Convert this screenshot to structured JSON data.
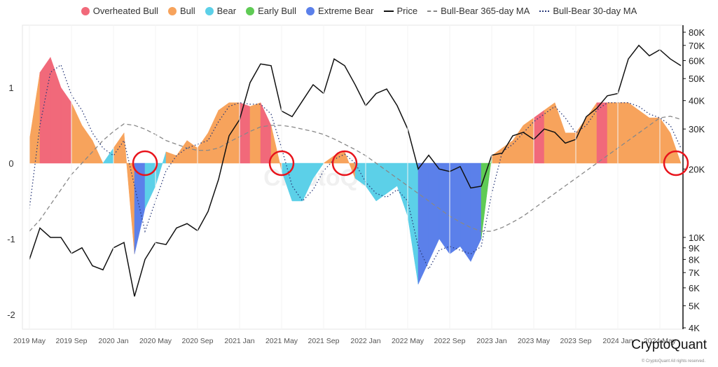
{
  "legend": [
    {
      "label": "Overheated Bull",
      "type": "dot",
      "color": "#f1697a"
    },
    {
      "label": "Bull",
      "type": "dot",
      "color": "#f7a35c"
    },
    {
      "label": "Bear",
      "type": "dot",
      "color": "#5cd0e8"
    },
    {
      "label": "Early Bull",
      "type": "dot",
      "color": "#5fcb55"
    },
    {
      "label": "Extreme Bear",
      "type": "dot",
      "color": "#5b80ea"
    },
    {
      "label": "Price",
      "type": "solid",
      "color": "#111111"
    },
    {
      "label": "Bull-Bear 365-day MA",
      "type": "dashed",
      "color": "#888888"
    },
    {
      "label": "Bull-Bear 30-day MA",
      "type": "dotted",
      "color": "#2a3a7a"
    }
  ],
  "brand": {
    "name": "CryptoQuant",
    "copyright": "© CryptoQuant All rights reserved.",
    "watermark": "CryptoQuant"
  },
  "chart_data": {
    "type": "area",
    "x_ticks": [
      "2019 May",
      "2019 Sep",
      "2020 Jan",
      "2020 May",
      "2020 Sep",
      "2021 Jan",
      "2021 May",
      "2021 Sep",
      "2022 Jan",
      "2022 May",
      "2022 Sep",
      "2023 Jan",
      "2023 May",
      "2023 Sep",
      "2024 Jan",
      "2024 May"
    ],
    "y_left": {
      "ticks": [
        "1",
        "0",
        "-1",
        "-2"
      ],
      "range": [
        -2.1,
        1.7
      ]
    },
    "y_right": {
      "scale": "log",
      "ticks": [
        "80K",
        "70K",
        "60K",
        "50K",
        "40K",
        "30K",
        "20K",
        "10K",
        "9K",
        "8K",
        "7K",
        "6K",
        "5K",
        "4K"
      ],
      "range": [
        4000,
        80000
      ]
    },
    "grid": false,
    "legend_position": "top",
    "regime_colors": {
      "overheated_bull": "#f1697a",
      "bull": "#f7a35c",
      "bear": "#5cd0e8",
      "early_bull": "#5fcb55",
      "extreme_bear": "#5b80ea"
    },
    "dates": [
      "2019-05",
      "2019-06",
      "2019-07",
      "2019-08",
      "2019-09",
      "2019-10",
      "2019-11",
      "2019-12",
      "2020-01",
      "2020-02",
      "2020-03",
      "2020-04",
      "2020-05",
      "2020-06",
      "2020-07",
      "2020-08",
      "2020-09",
      "2020-10",
      "2020-11",
      "2020-12",
      "2021-01",
      "2021-02",
      "2021-03",
      "2021-04",
      "2021-05",
      "2021-06",
      "2021-07",
      "2021-08",
      "2021-09",
      "2021-10",
      "2021-11",
      "2021-12",
      "2022-01",
      "2022-02",
      "2022-03",
      "2022-04",
      "2022-05",
      "2022-06",
      "2022-07",
      "2022-08",
      "2022-09",
      "2022-10",
      "2022-11",
      "2022-12",
      "2023-01",
      "2023-02",
      "2023-03",
      "2023-04",
      "2023-05",
      "2023-06",
      "2023-07",
      "2023-08",
      "2023-09",
      "2023-10",
      "2023-11",
      "2023-12",
      "2024-01",
      "2024-02",
      "2024-03",
      "2024-04",
      "2024-05",
      "2024-06",
      "2024-07"
    ],
    "bull_bear_index": [
      0.3,
      1.2,
      1.4,
      1.0,
      0.8,
      0.5,
      0.3,
      0.0,
      0.2,
      0.4,
      -1.2,
      -0.6,
      -0.3,
      0.15,
      0.1,
      0.3,
      0.2,
      0.4,
      0.7,
      0.8,
      0.8,
      0.75,
      0.8,
      0.5,
      -0.1,
      -0.5,
      -0.5,
      -0.2,
      0.0,
      0.1,
      0.15,
      -0.2,
      -0.3,
      -0.5,
      -0.4,
      -0.3,
      -0.7,
      -1.6,
      -1.3,
      -1.0,
      -1.2,
      -1.1,
      -1.3,
      -1.0,
      0.1,
      0.2,
      0.3,
      0.5,
      0.6,
      0.7,
      0.8,
      0.4,
      0.4,
      0.6,
      0.8,
      0.8,
      0.8,
      0.8,
      0.7,
      0.6,
      0.6,
      0.4,
      0.0
    ],
    "regime": [
      "bull",
      "overheated_bull",
      "overheated_bull",
      "overheated_bull",
      "bull",
      "bull",
      "bull",
      "bear",
      "bull",
      "bull",
      "extreme_bear",
      "bear",
      "bear",
      "bull",
      "bull",
      "bull",
      "bull",
      "bull",
      "bull",
      "bull",
      "overheated_bull",
      "bull",
      "overheated_bull",
      "bull",
      "bear",
      "bear",
      "bear",
      "bear",
      "bull",
      "bull",
      "bull",
      "bear",
      "bear",
      "bear",
      "bear",
      "bear",
      "bear",
      "extreme_bear",
      "extreme_bear",
      "extreme_bear",
      "extreme_bear",
      "extreme_bear",
      "extreme_bear",
      "early_bull",
      "bull",
      "bull",
      "bull",
      "bull",
      "overheated_bull",
      "bull",
      "bull",
      "bull",
      "bull",
      "bull",
      "overheated_bull",
      "bull",
      "bull",
      "bull",
      "bull",
      "bull",
      "bull",
      "bull",
      "bull"
    ],
    "ma_365": [
      -0.9,
      -0.75,
      -0.55,
      -0.35,
      -0.15,
      0.0,
      0.15,
      0.3,
      0.42,
      0.52,
      0.5,
      0.45,
      0.38,
      0.3,
      0.25,
      0.2,
      0.17,
      0.17,
      0.2,
      0.28,
      0.35,
      0.42,
      0.48,
      0.5,
      0.5,
      0.48,
      0.45,
      0.42,
      0.38,
      0.32,
      0.25,
      0.18,
      0.1,
      0.0,
      -0.1,
      -0.2,
      -0.3,
      -0.4,
      -0.5,
      -0.6,
      -0.7,
      -0.78,
      -0.85,
      -0.9,
      -0.9,
      -0.85,
      -0.78,
      -0.7,
      -0.6,
      -0.5,
      -0.4,
      -0.3,
      -0.2,
      -0.1,
      0.0,
      0.1,
      0.2,
      0.3,
      0.4,
      0.5,
      0.6,
      0.62,
      0.58
    ],
    "ma_30": [
      -0.6,
      0.5,
      1.2,
      1.3,
      0.9,
      0.7,
      0.4,
      0.2,
      0.1,
      0.3,
      -0.3,
      -0.9,
      -0.5,
      -0.1,
      0.1,
      0.2,
      0.25,
      0.3,
      0.55,
      0.75,
      0.8,
      0.78,
      0.78,
      0.65,
      0.2,
      -0.3,
      -0.5,
      -0.35,
      -0.1,
      0.05,
      0.12,
      0.0,
      -0.25,
      -0.4,
      -0.45,
      -0.35,
      -0.5,
      -1.1,
      -1.4,
      -1.15,
      -1.1,
      -1.15,
      -1.2,
      -1.1,
      -0.4,
      0.15,
      0.25,
      0.4,
      0.55,
      0.65,
      0.75,
      0.6,
      0.4,
      0.5,
      0.7,
      0.8,
      0.8,
      0.8,
      0.75,
      0.65,
      0.6,
      0.5,
      0.2
    ],
    "price": [
      8000,
      11000,
      10000,
      10000,
      8500,
      9000,
      7500,
      7200,
      9000,
      9500,
      5500,
      8000,
      9500,
      9300,
      11000,
      11500,
      10700,
      13000,
      18000,
      28000,
      33000,
      48000,
      58000,
      57000,
      36000,
      34000,
      40000,
      47000,
      43000,
      61000,
      57000,
      47000,
      38000,
      43000,
      45000,
      38000,
      30000,
      20000,
      23000,
      20000,
      19500,
      20500,
      16500,
      16800,
      23000,
      23500,
      28000,
      29000,
      27000,
      30000,
      29000,
      26000,
      27000,
      34000,
      37000,
      42000,
      43000,
      61000,
      70000,
      63000,
      67000,
      61000,
      57000
    ],
    "annotations": [
      {
        "type": "circle",
        "date": "2020-04"
      },
      {
        "type": "circle",
        "date": "2021-05"
      },
      {
        "type": "circle",
        "date": "2021-11"
      },
      {
        "type": "circle",
        "date": "2024-07"
      }
    ]
  }
}
